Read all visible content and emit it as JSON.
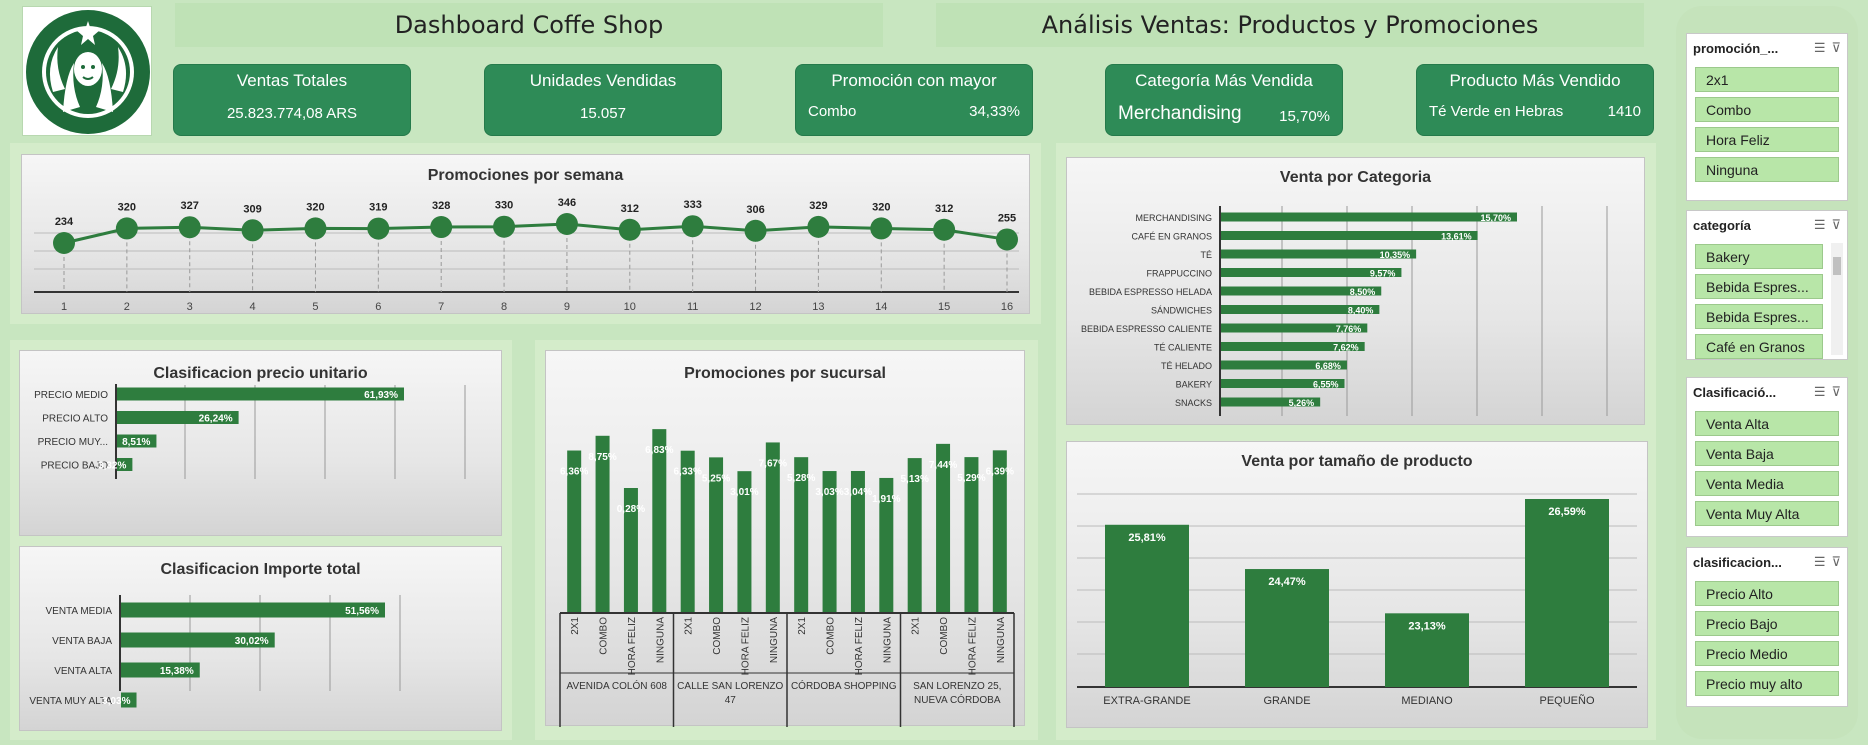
{
  "header": {
    "left_title": "Dashboard Coffe Shop",
    "right_title": "Análisis Ventas: Productos y Promociones"
  },
  "kpis": {
    "ventas": {
      "label": "Ventas Totales",
      "value": "25.823.774,08 ARS"
    },
    "unidades": {
      "label": "Unidades Vendidas",
      "value": "15.057"
    },
    "promocion": {
      "label": "Promoción con mayor",
      "name": "Combo",
      "value": "34,33%"
    },
    "categoria": {
      "label": "Categoría Más Vendida",
      "name": "Merchandising",
      "value": "15,70%"
    },
    "producto": {
      "label": "Producto Más Vendido",
      "name": "Té Verde en Hebras",
      "value": "1410"
    }
  },
  "chart_data": [
    {
      "id": "semana",
      "type": "line",
      "title": "Promociones por semana",
      "x": [
        1,
        2,
        3,
        4,
        5,
        6,
        7,
        8,
        9,
        10,
        11,
        12,
        13,
        14,
        15,
        16
      ],
      "values": [
        234,
        320,
        327,
        309,
        320,
        319,
        328,
        330,
        346,
        312,
        333,
        306,
        329,
        320,
        312,
        255
      ],
      "color": "#2e7d3e"
    },
    {
      "id": "precio",
      "type": "bar",
      "orientation": "horizontal",
      "title": "Clasificacion precio unitario",
      "categories": [
        "PRECIO MEDIO",
        "PRECIO ALTO",
        "PRECIO MUY...",
        "PRECIO BAJO"
      ],
      "values": [
        61.93,
        26.24,
        8.51,
        3.32
      ],
      "labels": [
        "61,93%",
        "26,24%",
        "8,51%",
        "3,32%"
      ]
    },
    {
      "id": "importe",
      "type": "bar",
      "orientation": "horizontal",
      "title": "Clasificacion Importe total",
      "categories": [
        "VENTA MEDIA",
        "VENTA BAJA",
        "VENTA ALTA",
        "VENTA MUY ALTA"
      ],
      "values": [
        51.56,
        30.02,
        15.38,
        3.03
      ],
      "labels": [
        "51,56%",
        "30,02%",
        "15,38%",
        "3,03%"
      ]
    },
    {
      "id": "sucursal",
      "type": "bar",
      "title": "Promociones por sucursal",
      "groups": [
        "AVENIDA COLÓN 608",
        "CALLE SAN LORENZO 47",
        "CÓRDOBA SHOPPING",
        "SAN LORENZO 25, NUEVA CÓRDOBA"
      ],
      "categories": [
        "2X1",
        "COMBO",
        "HORA FELIZ",
        "NINGUNA"
      ],
      "values": [
        26.36,
        28.75,
        20.28,
        29.83,
        26.33,
        25.25,
        23.01,
        27.67,
        25.28,
        23.03,
        23.04,
        21.91,
        25.13,
        27.44,
        25.29,
        26.39
      ],
      "labels": [
        "6,36%",
        "8,75%",
        "0,28%",
        "6,83%",
        "6,33%",
        "5,25%",
        "3,01%",
        "7,67%",
        "5,28%",
        "3,03%",
        "3,04%",
        "1,91%",
        "5,13%",
        "7,44%",
        "5,29%",
        "6,39%"
      ]
    },
    {
      "id": "categoria",
      "type": "bar",
      "orientation": "horizontal",
      "title": "Venta por Categoria",
      "categories": [
        "MERCHANDISING",
        "CAFÉ EN GRANOS",
        "TÉ",
        "FRAPPUCCINO",
        "BEBIDA ESPRESSO HELADA",
        "SÁNDWICHES",
        "BEBIDA ESPRESSO CALIENTE",
        "TÉ CALIENTE",
        "TÉ HELADO",
        "BAKERY",
        "SNACKS"
      ],
      "values": [
        15.7,
        13.61,
        10.35,
        9.57,
        8.5,
        8.4,
        7.76,
        7.62,
        6.68,
        6.55,
        5.26
      ],
      "labels": [
        "15,70%",
        "13,61%",
        "10,35%",
        "9,57%",
        "8,50%",
        "8,40%",
        "7,76%",
        "7,62%",
        "6,68%",
        "6,55%",
        "5,26%"
      ]
    },
    {
      "id": "tamano",
      "type": "bar",
      "title": "Venta por tamaño de producto",
      "categories": [
        "EXTRA-GRANDE",
        "GRANDE",
        "MEDIANO",
        "PEQUEÑO"
      ],
      "values": [
        25.81,
        24.47,
        23.13,
        26.59
      ],
      "labels": [
        "25,81%",
        "24,47%",
        "23,13%",
        "26,59%"
      ]
    }
  ],
  "slicers": [
    {
      "title": "promoción_...",
      "items": [
        "2x1",
        "Combo",
        "Hora Feliz",
        "Ninguna"
      ]
    },
    {
      "title": "categoría",
      "items": [
        "Bakery",
        "Bebida Espres...",
        "Bebida Espres...",
        "Café en Granos"
      ]
    },
    {
      "title": "Clasificació...",
      "items": [
        "Venta Alta",
        "Venta Baja",
        "Venta Media",
        "Venta Muy Alta"
      ]
    },
    {
      "title": "clasificacion...",
      "items": [
        "Precio Alto",
        "Precio Bajo",
        "Precio Medio",
        "Precio muy alto"
      ]
    }
  ]
}
